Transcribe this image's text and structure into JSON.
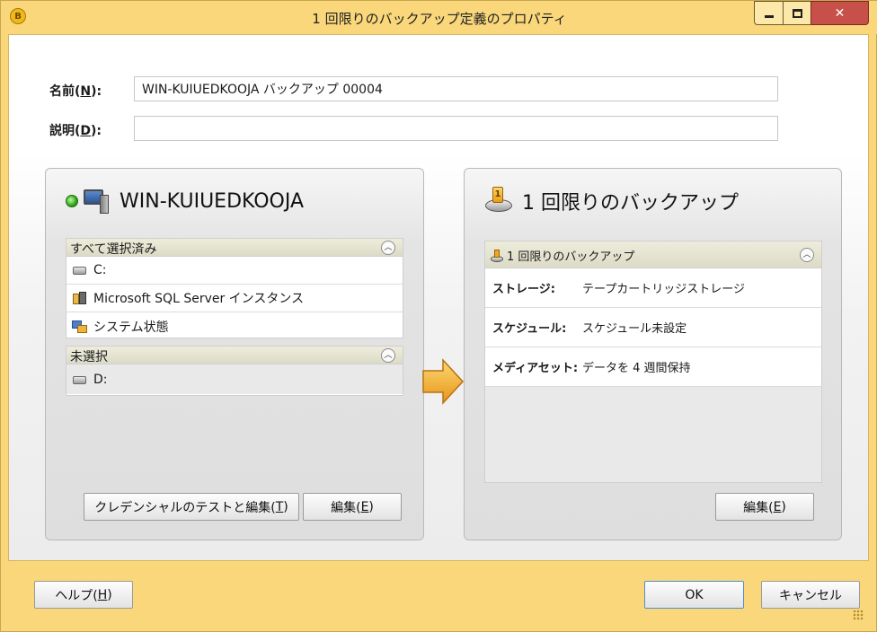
{
  "window": {
    "title": "1 回限りのバックアップ定義のプロパティ",
    "app_icon_text": "B"
  },
  "form": {
    "name_label_pre": "名前(",
    "name_label_key": "N",
    "name_label_post": "):",
    "name_value": "WIN-KUIUEDKOOJA バックアップ 00004",
    "desc_label_pre": "説明(",
    "desc_label_key": "D",
    "desc_label_post": "):",
    "desc_value": ""
  },
  "left_panel": {
    "title": "WIN-KUIUEDKOOJA",
    "selected_group": {
      "header": "すべて選択済み",
      "items": [
        {
          "label": "C:",
          "icon": "drive-icon"
        },
        {
          "label": "Microsoft SQL Server インスタンス",
          "icon": "sql-server-icon"
        },
        {
          "label": "システム状態",
          "icon": "system-state-icon"
        }
      ]
    },
    "unselected_group": {
      "header": "未選択",
      "items": [
        {
          "label": "D:",
          "icon": "drive-icon"
        }
      ]
    },
    "buttons": {
      "test_pre": "クレデンシャルのテストと編集(",
      "test_key": "T",
      "test_post": ")",
      "edit_pre": "編集(",
      "edit_key": "E",
      "edit_post": ")"
    }
  },
  "right_panel": {
    "title": "1 回限りのバックアップ",
    "group_header": "1 回限りのバックアップ",
    "properties": [
      {
        "key": "ストレージ:",
        "value": "テープカートリッジストレージ"
      },
      {
        "key": "スケジュール:",
        "value": "スケジュール未設定"
      },
      {
        "key": "メディアセット:",
        "value": "データを 4 週間保持"
      }
    ],
    "edit_pre": "編集(",
    "edit_key": "E",
    "edit_post": ")"
  },
  "footer": {
    "help_pre": "ヘルプ(",
    "help_key": "H",
    "help_post": ")",
    "ok_label": "OK",
    "cancel_label": "キャンセル"
  },
  "colors": {
    "frame": "#f9d77a",
    "arrow": "#f0a81e"
  }
}
